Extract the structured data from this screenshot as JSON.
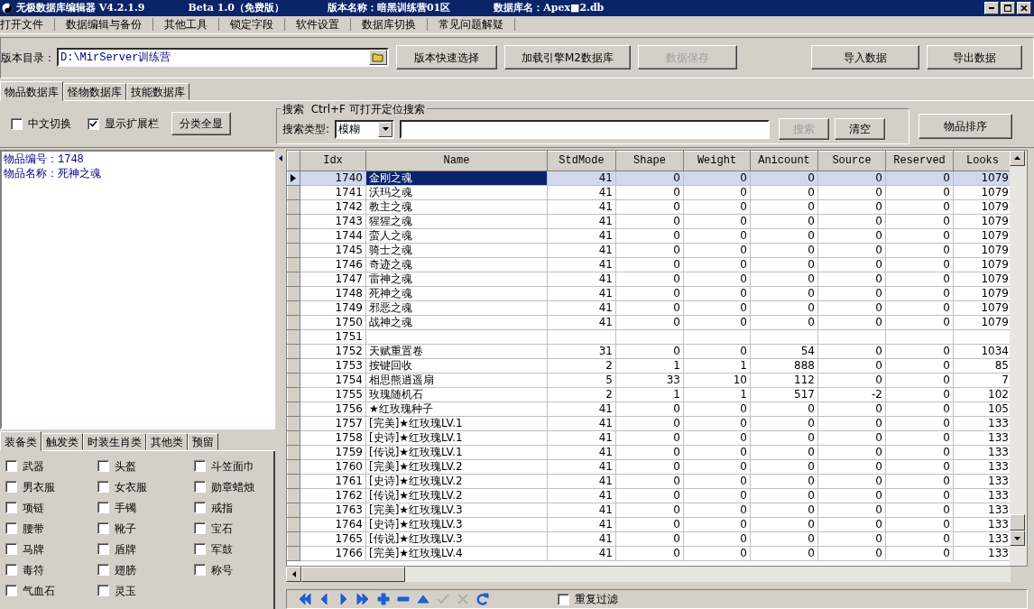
{
  "window": {
    "title_segments": [
      "无极数据库编辑器 V4.2.1.9",
      "Beta 1.0（免费版）",
      "版本名称：暗黑训练营01区",
      "数据库名：Apex■2.db"
    ]
  },
  "menu": [
    "打开文件",
    "数据编辑与备份",
    "其他工具",
    "锁定字段",
    "软件设置",
    "数据库切换",
    "常见问题解疑"
  ],
  "toolbar": {
    "directory_label": "版本目录：",
    "directory_value": "D:\\MirServer训练营",
    "buttons": [
      {
        "label": "版本快速选择",
        "disabled": false
      },
      {
        "label": "加载引擎M2数据库",
        "disabled": false
      },
      {
        "label": "数据保存",
        "disabled": true
      },
      {
        "label": "导入数据",
        "disabled": false
      },
      {
        "label": "导出数据",
        "disabled": false
      }
    ]
  },
  "db_tabs": [
    {
      "label": "物品数据库",
      "selected": true
    },
    {
      "label": "怪物数据库",
      "selected": false
    },
    {
      "label": "技能数据库",
      "selected": false
    }
  ],
  "options": {
    "checkboxes": [
      {
        "label": "中文切换",
        "checked": false
      },
      {
        "label": "显示扩展栏",
        "checked": true
      }
    ],
    "button": "分类全显"
  },
  "search": {
    "title": "搜索  Ctrl+F 可打开定位搜索",
    "type_label": "搜索类型:",
    "type_value": "模糊",
    "search_button": {
      "label": "搜索",
      "disabled": true
    },
    "clear_button": "清空"
  },
  "sort_button": "物品排序",
  "item_info": [
    "物品编号：1748",
    "物品名称：死神之魂"
  ],
  "category_tabs": [
    {
      "label": "装备类",
      "selected": true
    },
    {
      "label": "触发类",
      "selected": false
    },
    {
      "label": "时装生肖类",
      "selected": false
    },
    {
      "label": "其他类",
      "selected": false
    },
    {
      "label": "预留",
      "selected": false
    }
  ],
  "categories": [
    {
      "label": "武器",
      "checked": false
    },
    {
      "label": "头盔",
      "checked": false
    },
    {
      "label": "斗笠面巾",
      "checked": false
    },
    {
      "label": "男衣服",
      "checked": false
    },
    {
      "label": "女衣服",
      "checked": false
    },
    {
      "label": "勋章蜡烛",
      "checked": false
    },
    {
      "label": "项链",
      "checked": false
    },
    {
      "label": "手镯",
      "checked": false
    },
    {
      "label": "戒指",
      "checked": false
    },
    {
      "label": "腰带",
      "checked": false
    },
    {
      "label": "靴子",
      "checked": false
    },
    {
      "label": "宝石",
      "checked": false
    },
    {
      "label": "马牌",
      "checked": false
    },
    {
      "label": "盾牌",
      "checked": false
    },
    {
      "label": "军鼓",
      "checked": false
    },
    {
      "label": "毒符",
      "checked": false
    },
    {
      "label": "翅膀",
      "checked": false
    },
    {
      "label": "称号",
      "checked": false
    },
    {
      "label": "气血石",
      "checked": false
    },
    {
      "label": "灵玉",
      "checked": false
    }
  ],
  "table": {
    "columns": [
      "Idx",
      "Name",
      "StdMode",
      "Shape",
      "Weight",
      "Anicount",
      "Source",
      "Reserved",
      "Looks"
    ],
    "rows": [
      {
        "selected": true,
        "cells": [
          "1740",
          "金刚之魂",
          "41",
          "0",
          "0",
          "0",
          "0",
          "0",
          "1079"
        ]
      },
      {
        "selected": false,
        "cells": [
          "1741",
          "沃玛之魂",
          "41",
          "0",
          "0",
          "0",
          "0",
          "0",
          "1079"
        ]
      },
      {
        "selected": false,
        "cells": [
          "1742",
          "教主之魂",
          "41",
          "0",
          "0",
          "0",
          "0",
          "0",
          "1079"
        ]
      },
      {
        "selected": false,
        "cells": [
          "1743",
          "猩猩之魂",
          "41",
          "0",
          "0",
          "0",
          "0",
          "0",
          "1079"
        ]
      },
      {
        "selected": false,
        "cells": [
          "1744",
          "蛮人之魂",
          "41",
          "0",
          "0",
          "0",
          "0",
          "0",
          "1079"
        ]
      },
      {
        "selected": false,
        "cells": [
          "1745",
          "骑士之魂",
          "41",
          "0",
          "0",
          "0",
          "0",
          "0",
          "1079"
        ]
      },
      {
        "selected": false,
        "cells": [
          "1746",
          "奇迹之魂",
          "41",
          "0",
          "0",
          "0",
          "0",
          "0",
          "1079"
        ]
      },
      {
        "selected": false,
        "cells": [
          "1747",
          "雷神之魂",
          "41",
          "0",
          "0",
          "0",
          "0",
          "0",
          "1079"
        ]
      },
      {
        "selected": false,
        "cells": [
          "1748",
          "死神之魂",
          "41",
          "0",
          "0",
          "0",
          "0",
          "0",
          "1079"
        ]
      },
      {
        "selected": false,
        "cells": [
          "1749",
          "邪恶之魂",
          "41",
          "0",
          "0",
          "0",
          "0",
          "0",
          "1079"
        ]
      },
      {
        "selected": false,
        "cells": [
          "1750",
          "战神之魂",
          "41",
          "0",
          "0",
          "0",
          "0",
          "0",
          "1079"
        ]
      },
      {
        "selected": false,
        "cells": [
          "1751",
          null,
          null,
          null,
          null,
          null,
          null,
          null,
          null
        ]
      },
      {
        "selected": false,
        "cells": [
          "1752",
          "天赋重置卷",
          "31",
          "0",
          "0",
          "54",
          "0",
          "0",
          "1034"
        ]
      },
      {
        "selected": false,
        "cells": [
          "1753",
          "按键回收",
          "2",
          "1",
          "1",
          "888",
          "0",
          "0",
          "85"
        ]
      },
      {
        "selected": false,
        "cells": [
          "1754",
          "相思熊逍遥扇",
          "5",
          "33",
          "10",
          "112",
          "0",
          "0",
          "7"
        ]
      },
      {
        "selected": false,
        "cells": [
          "1755",
          "玫瑰随机石",
          "2",
          "1",
          "1",
          "517",
          "-2",
          "0",
          "102"
        ]
      },
      {
        "selected": false,
        "cells": [
          "1756",
          "★红玫瑰种子",
          "41",
          "0",
          "0",
          "0",
          "0",
          "0",
          "105"
        ]
      },
      {
        "selected": false,
        "cells": [
          "1757",
          "[完美]★红玫瑰LV.1",
          "41",
          "0",
          "0",
          "0",
          "0",
          "0",
          "133"
        ]
      },
      {
        "selected": false,
        "cells": [
          "1758",
          "[史诗]★红玫瑰LV.1",
          "41",
          "0",
          "0",
          "0",
          "0",
          "0",
          "133"
        ]
      },
      {
        "selected": false,
        "cells": [
          "1759",
          "[传说]★红玫瑰LV.1",
          "41",
          "0",
          "0",
          "0",
          "0",
          "0",
          "133"
        ]
      },
      {
        "selected": false,
        "cells": [
          "1760",
          "[完美]★红玫瑰LV.2",
          "41",
          "0",
          "0",
          "0",
          "0",
          "0",
          "133"
        ]
      },
      {
        "selected": false,
        "cells": [
          "1761",
          "[史诗]★红玫瑰LV.2",
          "41",
          "0",
          "0",
          "0",
          "0",
          "0",
          "133"
        ]
      },
      {
        "selected": false,
        "cells": [
          "1762",
          "[传说]★红玫瑰LV.2",
          "41",
          "0",
          "0",
          "0",
          "0",
          "0",
          "133"
        ]
      },
      {
        "selected": false,
        "cells": [
          "1763",
          "[完美]★红玫瑰LV.3",
          "41",
          "0",
          "0",
          "0",
          "0",
          "0",
          "133"
        ]
      },
      {
        "selected": false,
        "cells": [
          "1764",
          "[史诗]★红玫瑰LV.3",
          "41",
          "0",
          "0",
          "0",
          "0",
          "0",
          "133"
        ]
      },
      {
        "selected": false,
        "cells": [
          "1765",
          "[传说]★红玫瑰LV.3",
          "41",
          "0",
          "0",
          "0",
          "0",
          "0",
          "133"
        ]
      },
      {
        "selected": false,
        "cells": [
          "1766",
          "[完美]★红玫瑰LV.4",
          "41",
          "0",
          "0",
          "0",
          "0",
          "0",
          "133"
        ]
      }
    ]
  },
  "navigator": {
    "buttons": [
      {
        "kind": "first",
        "disabled": false
      },
      {
        "kind": "prior",
        "disabled": false
      },
      {
        "kind": "next",
        "disabled": false
      },
      {
        "kind": "last",
        "disabled": false
      },
      {
        "kind": "insert",
        "disabled": false
      },
      {
        "kind": "delete",
        "disabled": false
      },
      {
        "kind": "edit",
        "disabled": false
      },
      {
        "kind": "post",
        "disabled": true
      },
      {
        "kind": "cancel",
        "disabled": true
      },
      {
        "kind": "refresh",
        "disabled": false
      }
    ]
  },
  "filter": {
    "label": "重复过滤",
    "checked": false
  }
}
